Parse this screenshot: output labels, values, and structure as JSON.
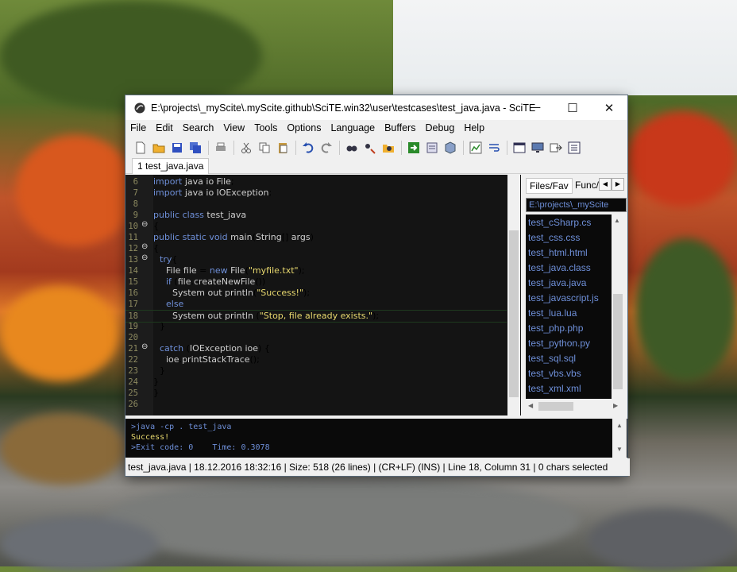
{
  "window": {
    "title": "E:\\projects\\_myScite\\.myScite.github\\SciTE.win32\\user\\testcases\\test_java.java - SciTE",
    "minimize_glyph": "─",
    "maximize_glyph": "☐",
    "close_glyph": "✕"
  },
  "menu": [
    "File",
    "Edit",
    "Search",
    "View",
    "Tools",
    "Options",
    "Language",
    "Buffers",
    "Debug",
    "Help"
  ],
  "toolbar_icons": [
    "new-file-icon",
    "open-folder-icon",
    "save-icon",
    "save-all-icon",
    "print-icon",
    "cut-icon",
    "copy-icon",
    "paste-icon",
    "undo-icon",
    "redo-icon",
    "find-icon",
    "find-replace-icon",
    "find-in-files-icon",
    "run-icon",
    "compile-icon",
    "build-icon",
    "macro-icon",
    "wrap-icon",
    "window-icon",
    "monitor-icon",
    "export-icon",
    "properties-icon"
  ],
  "tab": {
    "label": "1 test_java.java"
  },
  "editor": {
    "lines": [
      {
        "n": "6",
        "text": "import java.io.File;"
      },
      {
        "n": "7",
        "text": "import java.io.IOException;"
      },
      {
        "n": "8",
        "text": ""
      },
      {
        "n": "9",
        "text": "public class test_java"
      },
      {
        "n": "10",
        "text": "{"
      },
      {
        "n": "11",
        "text": "public static void main(String[] args)"
      },
      {
        "n": "12",
        "text": "{"
      },
      {
        "n": "13",
        "text": "try{"
      },
      {
        "n": "14",
        "text": "File file = new File(\"myfile.txt\");"
      },
      {
        "n": "15",
        "text": "if (file.createNewFile())"
      },
      {
        "n": "16",
        "text": "System.out.println(\"Success!\");"
      },
      {
        "n": "17",
        "text": "else"
      },
      {
        "n": "18",
        "text": "System.out.println (\"Stop, file already exists.\");"
      },
      {
        "n": "19",
        "text": "}"
      },
      {
        "n": "20",
        "text": ""
      },
      {
        "n": "21",
        "text": "catch (IOException ioe) {"
      },
      {
        "n": "22",
        "text": "ioe.printStackTrace();"
      },
      {
        "n": "23",
        "text": "}"
      },
      {
        "n": "24",
        "text": "}"
      },
      {
        "n": "25",
        "text": "}"
      },
      {
        "n": "26",
        "text": ""
      }
    ]
  },
  "side_panel": {
    "tab_files": "Files/Fav",
    "tab_func": "Func/",
    "path": "E:\\projects\\_myScite",
    "files": [
      "test_cSharp.cs",
      "test_css.css",
      "test_html.html",
      "test_java.class",
      "test_java.java",
      "test_javascript.js",
      "test_lua.lua",
      "test_php.php",
      "test_python.py",
      "test_sql.sql",
      "test_vbs.vbs",
      "test_xml.xml"
    ]
  },
  "output": {
    "lines": [
      ">java -cp . test_java",
      "Success!",
      ">Exit code: 0    Time: 0.3078"
    ]
  },
  "status": "test_java.java | 18.12.2016 18:32:16 | Size: 518 (26 lines) | (CR+LF) (INS) | Line 18, Column 31 | 0 chars selected",
  "colors": {
    "keyword": "#6e8fd8",
    "identifier": "#cfcfcf",
    "string": "#e8d86e",
    "output_cmd": "#6e8fd8",
    "output_ok": "#e8d86e"
  }
}
